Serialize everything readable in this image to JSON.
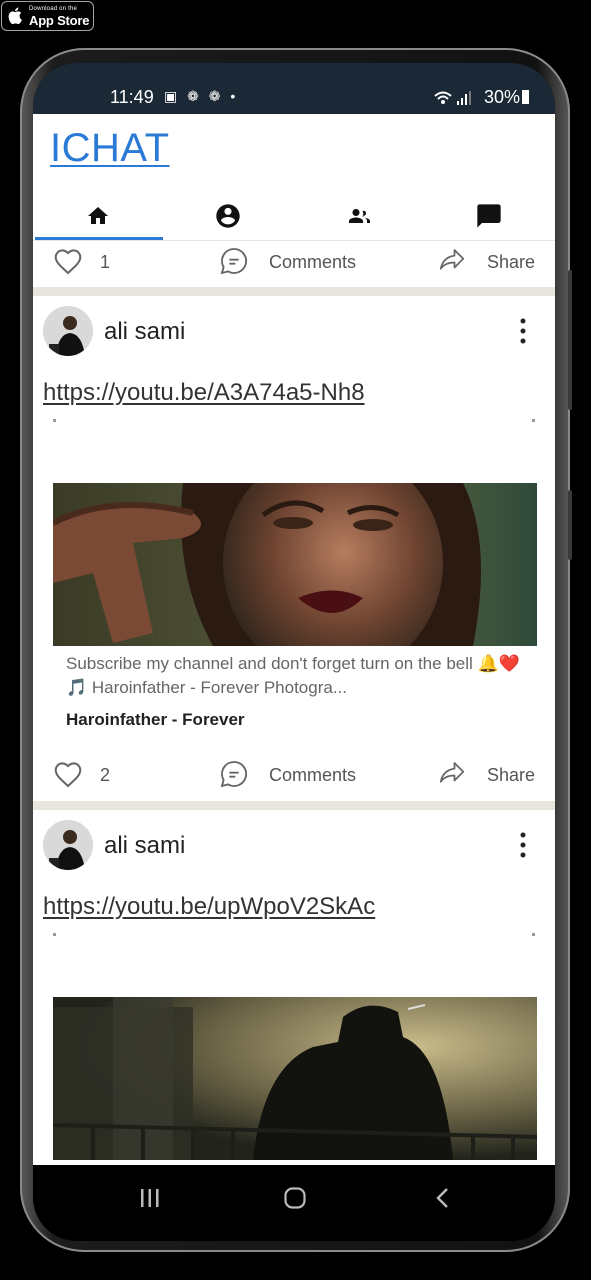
{
  "store_badge": {
    "line1": "Download on the",
    "line2": "App Store"
  },
  "status_bar": {
    "time": "11:49",
    "notif_icons": "▣ ❁ ❁ •",
    "battery": "30%"
  },
  "app": {
    "title": "ICHAT"
  },
  "tabs": [
    {
      "icon": "home-icon",
      "active": true
    },
    {
      "icon": "account-circle-icon",
      "active": false
    },
    {
      "icon": "people-icon",
      "active": false
    },
    {
      "icon": "chat-icon",
      "active": false
    }
  ],
  "top_actions": {
    "likes": "1",
    "comments_label": "Comments",
    "share_label": "Share"
  },
  "posts": [
    {
      "author": "ali sami",
      "link": "https://youtu.be/A3A74a5-Nh8",
      "preview": {
        "description": "Subscribe my channel and don't forget turn on the bell 🔔❤️🎵 Haroinfather - Forever Photogra...",
        "title": "Haroinfather -  Forever"
      },
      "likes": "2",
      "comments_label": "Comments",
      "share_label": "Share"
    },
    {
      "author": "ali sami",
      "link": "https://youtu.be/upWpoV2SkAc"
    }
  ],
  "colors": {
    "accent": "#2b7bd6",
    "status_bar": "#1b2836",
    "separator": "#e8e5df"
  }
}
